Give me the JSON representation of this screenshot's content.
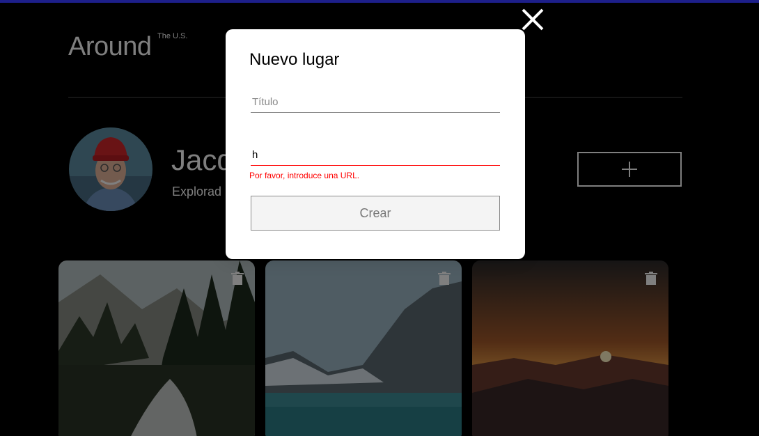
{
  "header": {
    "logo_text": "Around",
    "logo_superscript": "The U.S."
  },
  "profile": {
    "name": "Jacq",
    "about": "Explorad"
  },
  "cards": [
    {
      "scene": "forest-river"
    },
    {
      "scene": "mountain-lake"
    },
    {
      "scene": "sunset-mountains"
    }
  ],
  "modal": {
    "title": "Nuevo lugar",
    "title_field": {
      "value": "",
      "placeholder": "Título"
    },
    "url_field": {
      "value": "h",
      "placeholder": ""
    },
    "url_error": "Por favor, introduce una URL.",
    "submit_label": "Crear"
  },
  "icons": {
    "close": "close-icon",
    "add": "plus-icon",
    "delete": "trash-icon"
  },
  "colors": {
    "page_bg": "#000000",
    "error": "#ff0000",
    "modal_bg": "#ffffff"
  }
}
